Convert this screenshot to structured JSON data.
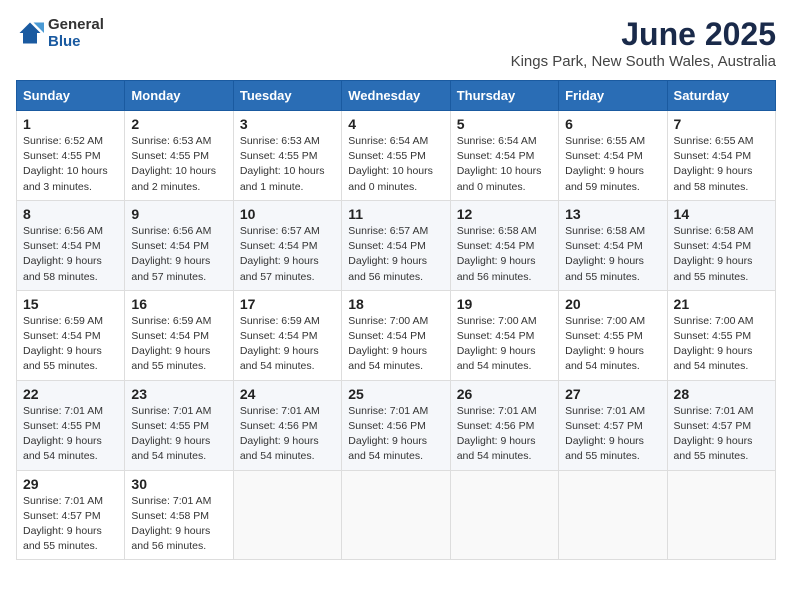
{
  "logo": {
    "general": "General",
    "blue": "Blue"
  },
  "header": {
    "title": "June 2025",
    "subtitle": "Kings Park, New South Wales, Australia"
  },
  "weekdays": [
    "Sunday",
    "Monday",
    "Tuesday",
    "Wednesday",
    "Thursday",
    "Friday",
    "Saturday"
  ],
  "weeks": [
    [
      {
        "day": "1",
        "sunrise": "6:52 AM",
        "sunset": "4:55 PM",
        "daylight": "10 hours and 3 minutes."
      },
      {
        "day": "2",
        "sunrise": "6:53 AM",
        "sunset": "4:55 PM",
        "daylight": "10 hours and 2 minutes."
      },
      {
        "day": "3",
        "sunrise": "6:53 AM",
        "sunset": "4:55 PM",
        "daylight": "10 hours and 1 minute."
      },
      {
        "day": "4",
        "sunrise": "6:54 AM",
        "sunset": "4:55 PM",
        "daylight": "10 hours and 0 minutes."
      },
      {
        "day": "5",
        "sunrise": "6:54 AM",
        "sunset": "4:54 PM",
        "daylight": "10 hours and 0 minutes."
      },
      {
        "day": "6",
        "sunrise": "6:55 AM",
        "sunset": "4:54 PM",
        "daylight": "9 hours and 59 minutes."
      },
      {
        "day": "7",
        "sunrise": "6:55 AM",
        "sunset": "4:54 PM",
        "daylight": "9 hours and 58 minutes."
      }
    ],
    [
      {
        "day": "8",
        "sunrise": "6:56 AM",
        "sunset": "4:54 PM",
        "daylight": "9 hours and 58 minutes."
      },
      {
        "day": "9",
        "sunrise": "6:56 AM",
        "sunset": "4:54 PM",
        "daylight": "9 hours and 57 minutes."
      },
      {
        "day": "10",
        "sunrise": "6:57 AM",
        "sunset": "4:54 PM",
        "daylight": "9 hours and 57 minutes."
      },
      {
        "day": "11",
        "sunrise": "6:57 AM",
        "sunset": "4:54 PM",
        "daylight": "9 hours and 56 minutes."
      },
      {
        "day": "12",
        "sunrise": "6:58 AM",
        "sunset": "4:54 PM",
        "daylight": "9 hours and 56 minutes."
      },
      {
        "day": "13",
        "sunrise": "6:58 AM",
        "sunset": "4:54 PM",
        "daylight": "9 hours and 55 minutes."
      },
      {
        "day": "14",
        "sunrise": "6:58 AM",
        "sunset": "4:54 PM",
        "daylight": "9 hours and 55 minutes."
      }
    ],
    [
      {
        "day": "15",
        "sunrise": "6:59 AM",
        "sunset": "4:54 PM",
        "daylight": "9 hours and 55 minutes."
      },
      {
        "day": "16",
        "sunrise": "6:59 AM",
        "sunset": "4:54 PM",
        "daylight": "9 hours and 55 minutes."
      },
      {
        "day": "17",
        "sunrise": "6:59 AM",
        "sunset": "4:54 PM",
        "daylight": "9 hours and 54 minutes."
      },
      {
        "day": "18",
        "sunrise": "7:00 AM",
        "sunset": "4:54 PM",
        "daylight": "9 hours and 54 minutes."
      },
      {
        "day": "19",
        "sunrise": "7:00 AM",
        "sunset": "4:54 PM",
        "daylight": "9 hours and 54 minutes."
      },
      {
        "day": "20",
        "sunrise": "7:00 AM",
        "sunset": "4:55 PM",
        "daylight": "9 hours and 54 minutes."
      },
      {
        "day": "21",
        "sunrise": "7:00 AM",
        "sunset": "4:55 PM",
        "daylight": "9 hours and 54 minutes."
      }
    ],
    [
      {
        "day": "22",
        "sunrise": "7:01 AM",
        "sunset": "4:55 PM",
        "daylight": "9 hours and 54 minutes."
      },
      {
        "day": "23",
        "sunrise": "7:01 AM",
        "sunset": "4:55 PM",
        "daylight": "9 hours and 54 minutes."
      },
      {
        "day": "24",
        "sunrise": "7:01 AM",
        "sunset": "4:56 PM",
        "daylight": "9 hours and 54 minutes."
      },
      {
        "day": "25",
        "sunrise": "7:01 AM",
        "sunset": "4:56 PM",
        "daylight": "9 hours and 54 minutes."
      },
      {
        "day": "26",
        "sunrise": "7:01 AM",
        "sunset": "4:56 PM",
        "daylight": "9 hours and 54 minutes."
      },
      {
        "day": "27",
        "sunrise": "7:01 AM",
        "sunset": "4:57 PM",
        "daylight": "9 hours and 55 minutes."
      },
      {
        "day": "28",
        "sunrise": "7:01 AM",
        "sunset": "4:57 PM",
        "daylight": "9 hours and 55 minutes."
      }
    ],
    [
      {
        "day": "29",
        "sunrise": "7:01 AM",
        "sunset": "4:57 PM",
        "daylight": "9 hours and 55 minutes."
      },
      {
        "day": "30",
        "sunrise": "7:01 AM",
        "sunset": "4:58 PM",
        "daylight": "9 hours and 56 minutes."
      },
      null,
      null,
      null,
      null,
      null
    ]
  ],
  "labels": {
    "sunrise": "Sunrise:",
    "sunset": "Sunset:",
    "daylight": "Daylight:"
  }
}
